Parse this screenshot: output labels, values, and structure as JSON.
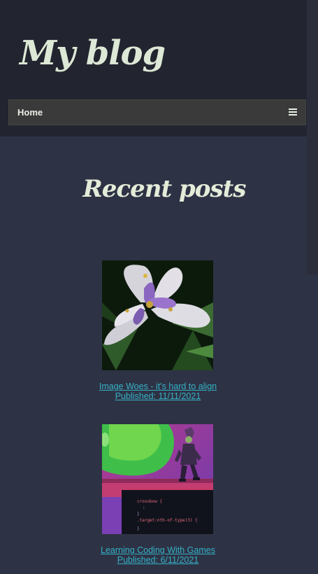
{
  "header": {
    "site_title": "My blog",
    "nav": {
      "home_label": "Home"
    }
  },
  "main": {
    "section_title": "Recent posts",
    "posts": [
      {
        "title": "Image Woes - it's hard to align",
        "published": "Published: 11/11/2021"
      },
      {
        "title": "Learning Coding With Games",
        "published": "Published: 6/11/2021"
      }
    ]
  },
  "colors": {
    "page_bg": "#2e3245",
    "header_bg": "#22252f",
    "link": "#35b2c6",
    "title_text": "#dde8d6"
  },
  "icons": {
    "menu_toggle": "hamburger-menu-icon"
  }
}
